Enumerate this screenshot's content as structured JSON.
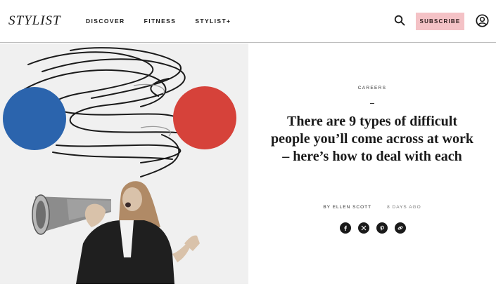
{
  "header": {
    "logo": "STYLIST",
    "nav": [
      "DISCOVER",
      "FITNESS",
      "STYLIST+"
    ],
    "subscribe_label": "SUBSCRIBE",
    "search_icon": "search-icon",
    "account_icon": "account-icon"
  },
  "hero": {
    "left_circle_color": "#2b64ad",
    "right_circle_color": "#d6423a"
  },
  "article": {
    "category": "CAREERS",
    "title": "There are 9 types of difficult people you’ll come across at work – here’s how to deal with each",
    "author": "BY ELLEN SCOTT",
    "date": "8 DAYS AGO",
    "share_icons": [
      "facebook-icon",
      "x-icon",
      "pinterest-icon",
      "link-icon"
    ]
  },
  "colors": {
    "subscribe_bg": "#f4c2c6",
    "text": "#1a1a1a"
  }
}
